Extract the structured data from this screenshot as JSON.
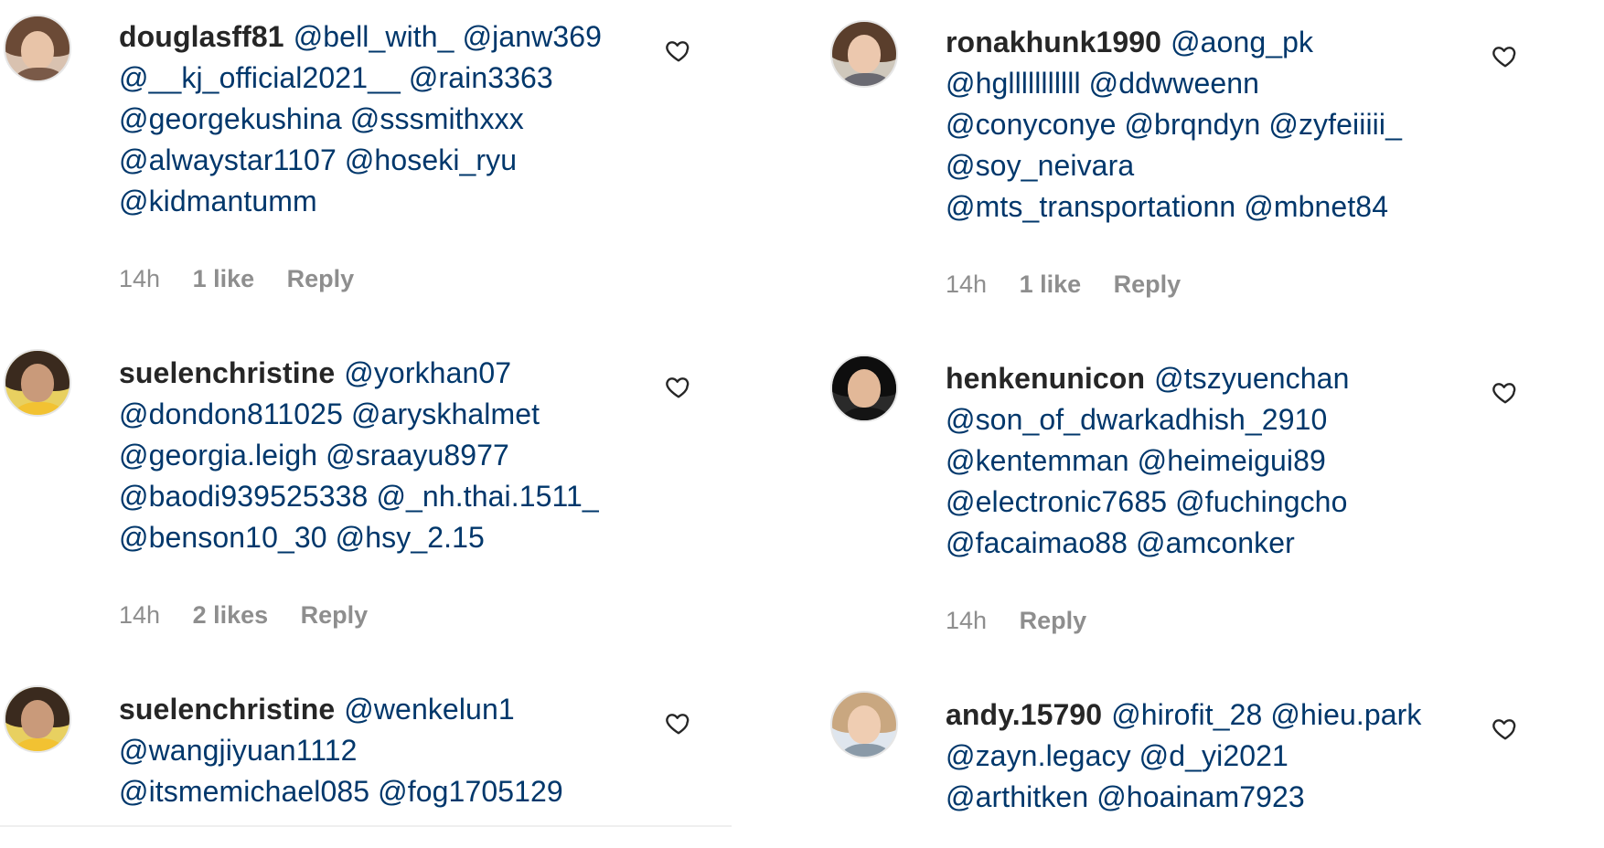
{
  "colors": {
    "username": "#262626",
    "mention": "#00376b",
    "meta": "#8e8e8e",
    "heart": "#262626"
  },
  "left_column": [
    {
      "username": "douglasff81",
      "mention_lines": [
        "@bell_with_ @janw369",
        "@__kj_official2021__ @rain3363",
        "@georgekushina @sssmithxxx",
        "@alwaystar1107 @hoseki_ryu",
        "@kidmantumm"
      ],
      "time": "14h",
      "likes": "1 like",
      "reply": "Reply",
      "like_icon": "heart-outline-icon"
    },
    {
      "username": "suelenchristine",
      "mention_lines": [
        "@yorkhan07",
        "@dondon811025 @aryskhalmet",
        "@georgia.leigh @sraayu8977",
        "@baodi939525338 @_nh.thai.1511_",
        "@benson10_30 @hsy_2.15"
      ],
      "time": "14h",
      "likes": "2 likes",
      "reply": "Reply",
      "like_icon": "heart-outline-icon"
    },
    {
      "username": "suelenchristine",
      "mention_lines": [
        "@wenkelun1",
        "@wangjiyuan1112",
        "@itsmemichael085 @fog1705129"
      ],
      "like_icon": "heart-outline-icon"
    }
  ],
  "right_column": [
    {
      "username": "ronakhunk1990",
      "mention_lines": [
        "@aong_pk",
        "@hglllllllllll @ddwweenn",
        "@conyconye @brqndyn @zyfeiiiii_",
        "@soy_neivara",
        "@mts_transportationn @mbnet84"
      ],
      "time": "14h",
      "likes": "1 like",
      "reply": "Reply",
      "like_icon": "heart-outline-icon"
    },
    {
      "username": "henkenunicon",
      "mention_lines": [
        "@tszyuenchan",
        "@son_of_dwarkadhish_2910",
        "@kentemman @heimeigui89",
        "@electronic7685 @fuchingcho",
        "@facaimao88 @amconker"
      ],
      "time": "14h",
      "reply": "Reply",
      "like_icon": "heart-outline-icon"
    },
    {
      "username": "andy.15790",
      "mention_lines": [
        "@hirofit_28 @hieu.park",
        "@zayn.legacy @d_yi2021",
        "@arthitken @hoainam7923"
      ],
      "like_icon": "heart-outline-icon"
    }
  ]
}
